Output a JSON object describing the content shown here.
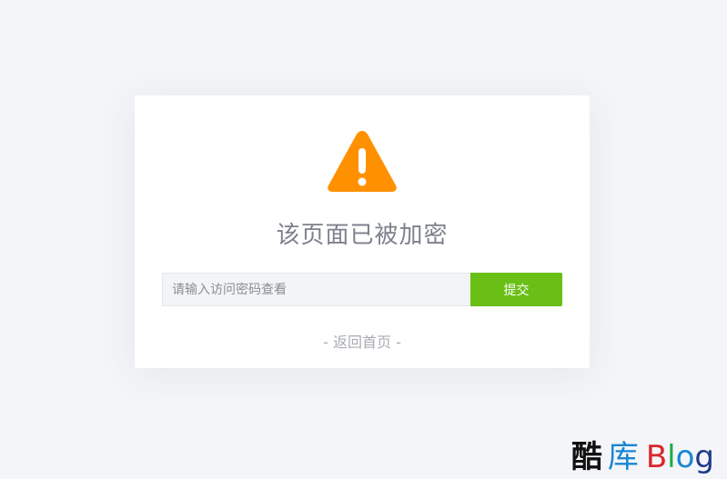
{
  "card": {
    "title": "该页面已被加密",
    "warning_icon": "warning-triangle-icon",
    "warning_color": "#ff9000"
  },
  "form": {
    "password_placeholder": "请输入访问密码查看",
    "password_value": "",
    "submit_label": "提交",
    "submit_color": "#6abf16"
  },
  "back_link": {
    "label": "- 返回首页 -"
  },
  "logo": {
    "char1": "酷",
    "char2": "库",
    "B": "B",
    "l": "l",
    "o": "o",
    "g": "g"
  },
  "colors": {
    "background": "#f4f5f8",
    "card": "#ffffff",
    "title_text": "#7d818c",
    "link_text": "#a9acb3"
  }
}
